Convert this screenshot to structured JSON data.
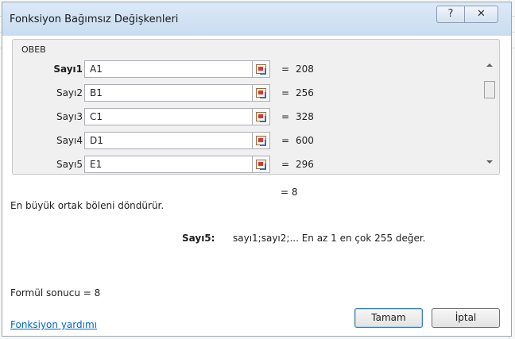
{
  "window": {
    "title": "Fonksiyon Bağımsız Değişkenleri",
    "help_glyph": "?",
    "close_glyph": "✕"
  },
  "function": {
    "name": "OBEB",
    "arguments": [
      {
        "label": "Sayı1",
        "value": "A1",
        "result": "208"
      },
      {
        "label": "Sayı2",
        "value": "B1",
        "result": "256"
      },
      {
        "label": "Sayı3",
        "value": "C1",
        "result": "328"
      },
      {
        "label": "Sayı4",
        "value": "D1",
        "result": "600"
      },
      {
        "label": "Sayı5",
        "value": "E1",
        "result": "296"
      }
    ],
    "equals": "=",
    "result_line": "= 8",
    "description": "En büyük ortak böleni döndürür.",
    "arg_description_name": "Sayı5:",
    "arg_description_text": "sayı1;sayı2;... En az 1 en çok 255 değer."
  },
  "footer": {
    "formula_result": "Formül sonucu =  8",
    "help_link": "Fonksiyon yardımı",
    "ok_label": "Tamam",
    "cancel_label": "İptal"
  },
  "icons": {
    "ref_button": "collapse-dialog-icon",
    "scroll_up": "scroll-up-arrow",
    "scroll_down": "scroll-down-arrow"
  }
}
